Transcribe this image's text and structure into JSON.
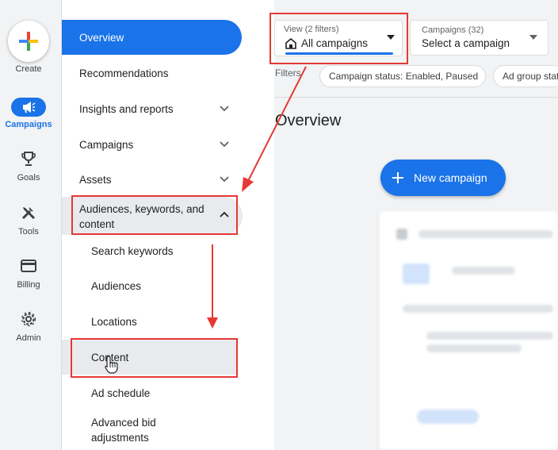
{
  "rail": {
    "create_label": "Create",
    "items": [
      {
        "label": "Campaigns",
        "icon": "megaphone-icon"
      },
      {
        "label": "Goals",
        "icon": "trophy-icon"
      },
      {
        "label": "Tools",
        "icon": "tools-icon"
      },
      {
        "label": "Billing",
        "icon": "credit-card-icon"
      },
      {
        "label": "Admin",
        "icon": "gear-icon"
      }
    ]
  },
  "nav": {
    "overview": "Overview",
    "recommendations": "Recommendations",
    "insights": "Insights and reports",
    "campaigns": "Campaigns",
    "assets": "Assets",
    "audiences_line1": "Audiences, keywords, and",
    "audiences_line2": "content",
    "sub": {
      "search_keywords": "Search keywords",
      "audiences": "Audiences",
      "locations": "Locations",
      "content": "Content",
      "ad_schedule": "Ad schedule",
      "advanced_line1": "Advanced bid",
      "advanced_line2": "adjustments"
    }
  },
  "header": {
    "view_label": "View (2 filters)",
    "view_value": "All campaigns",
    "campaigns_label": "Campaigns (32)",
    "campaigns_value": "Select a campaign"
  },
  "filters": {
    "label": "Filters",
    "chips": [
      "Campaign status: Enabled, Paused",
      "Ad group stat"
    ]
  },
  "main": {
    "title": "Overview",
    "new_campaign": "New campaign"
  },
  "colors": {
    "accent": "#1a73e8",
    "highlight": "#e53935"
  }
}
